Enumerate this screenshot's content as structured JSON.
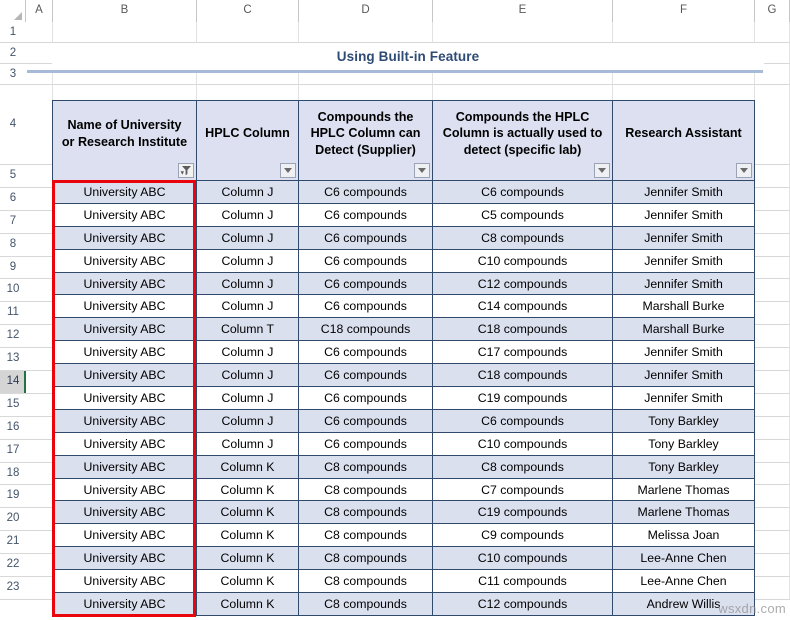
{
  "app": {
    "kind": "spreadsheet",
    "watermark": "wsxdn.com"
  },
  "grid": {
    "column_letters": [
      "A",
      "B",
      "C",
      "D",
      "E",
      "F",
      "G"
    ],
    "row_numbers": [
      "1",
      "2",
      "3",
      "4",
      "5",
      "6",
      "7",
      "8",
      "9",
      "10",
      "11",
      "12",
      "13",
      "14",
      "15",
      "16",
      "17",
      "18",
      "19",
      "20",
      "21",
      "22",
      "23"
    ],
    "active_row": "14",
    "select_all_icon": "select-all-triangle-icon"
  },
  "title": {
    "text": "Using Built-in Feature",
    "color": "#2e4b76",
    "underline_color": "#a8bada"
  },
  "table": {
    "header_fill": "#dce0f0",
    "band_fill": "#dbe0ef",
    "border_color": "#31496b",
    "columns": [
      {
        "label": "Name of University or Research Institute",
        "filter": "filtered",
        "icon": "filter-funnel-icon"
      },
      {
        "label": "HPLC Column",
        "filter": "dropdown",
        "icon": "chevron-down-icon"
      },
      {
        "label": "Compounds the HPLC Column can Detect (Supplier)",
        "filter": "dropdown",
        "icon": "chevron-down-icon"
      },
      {
        "label": "Compounds the HPLC Column is actually used to detect (specific lab)",
        "filter": "dropdown",
        "icon": "chevron-down-icon"
      },
      {
        "label": "Research Assistant",
        "filter": "dropdown",
        "icon": "chevron-down-icon"
      }
    ],
    "rows": [
      {
        "row": "5",
        "university": "University ABC",
        "column": "Column J",
        "supplier": "C6 compounds",
        "lab": "C6 compounds",
        "assistant": "Jennifer Smith"
      },
      {
        "row": "6",
        "university": "University ABC",
        "column": "Column J",
        "supplier": "C6 compounds",
        "lab": "C5 compounds",
        "assistant": "Jennifer Smith"
      },
      {
        "row": "7",
        "university": "University ABC",
        "column": "Column J",
        "supplier": "C6 compounds",
        "lab": "C8 compounds",
        "assistant": "Jennifer Smith"
      },
      {
        "row": "8",
        "university": "University ABC",
        "column": "Column J",
        "supplier": "C6 compounds",
        "lab": "C10 compounds",
        "assistant": "Jennifer Smith"
      },
      {
        "row": "9",
        "university": "University ABC",
        "column": "Column J",
        "supplier": "C6 compounds",
        "lab": "C12 compounds",
        "assistant": "Jennifer Smith"
      },
      {
        "row": "10",
        "university": "University ABC",
        "column": "Column J",
        "supplier": "C6 compounds",
        "lab": "C14 compounds",
        "assistant": "Marshall Burke"
      },
      {
        "row": "11",
        "university": "University ABC",
        "column": "Column T",
        "supplier": "C18 compounds",
        "lab": "C18 compounds",
        "assistant": "Marshall Burke"
      },
      {
        "row": "12",
        "university": "University ABC",
        "column": "Column J",
        "supplier": "C6 compounds",
        "lab": "C17 compounds",
        "assistant": "Jennifer Smith"
      },
      {
        "row": "13",
        "university": "University ABC",
        "column": "Column J",
        "supplier": "C6 compounds",
        "lab": "C18 compounds",
        "assistant": "Jennifer Smith"
      },
      {
        "row": "14",
        "university": "University ABC",
        "column": "Column J",
        "supplier": "C6 compounds",
        "lab": "C19 compounds",
        "assistant": "Jennifer Smith"
      },
      {
        "row": "15",
        "university": "University ABC",
        "column": "Column J",
        "supplier": "C6 compounds",
        "lab": "C6 compounds",
        "assistant": "Tony Barkley"
      },
      {
        "row": "16",
        "university": "University ABC",
        "column": "Column J",
        "supplier": "C6 compounds",
        "lab": "C10 compounds",
        "assistant": "Tony Barkley"
      },
      {
        "row": "17",
        "university": "University ABC",
        "column": "Column K",
        "supplier": "C8 compounds",
        "lab": "C8 compounds",
        "assistant": "Tony Barkley"
      },
      {
        "row": "18",
        "university": "University ABC",
        "column": "Column K",
        "supplier": "C8 compounds",
        "lab": "C7 compounds",
        "assistant": "Marlene Thomas"
      },
      {
        "row": "19",
        "university": "University ABC",
        "column": "Column K",
        "supplier": "C8 compounds",
        "lab": "C19 compounds",
        "assistant": "Marlene Thomas"
      },
      {
        "row": "20",
        "university": "University ABC",
        "column": "Column K",
        "supplier": "C8 compounds",
        "lab": "C9 compounds",
        "assistant": "Melissa Joan"
      },
      {
        "row": "21",
        "university": "University ABC",
        "column": "Column K",
        "supplier": "C8 compounds",
        "lab": "C10 compounds",
        "assistant": "Lee-Anne Chen"
      },
      {
        "row": "22",
        "university": "University ABC",
        "column": "Column K",
        "supplier": "C8 compounds",
        "lab": "C11 compounds",
        "assistant": "Lee-Anne Chen"
      },
      {
        "row": "23",
        "university": "University ABC",
        "column": "Column K",
        "supplier": "C8 compounds",
        "lab": "C12 compounds",
        "assistant": "Andrew Willis"
      }
    ]
  },
  "highlight": {
    "name": "red-selection-box",
    "color": "#e8050b",
    "targets_column": "Name of University or Research Institute"
  }
}
